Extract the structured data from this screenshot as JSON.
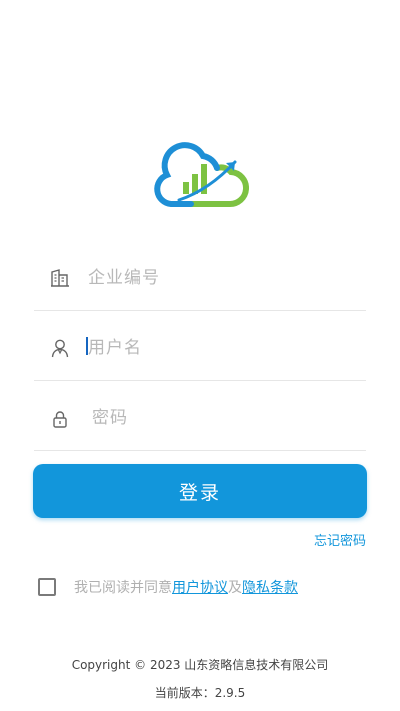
{
  "logo": {
    "icon": "cloud-chart-logo",
    "colors": {
      "blue": "#1e8fd6",
      "green": "#7dc242"
    }
  },
  "form": {
    "company_placeholder": "企业编号",
    "username_placeholder": "用户名",
    "password_placeholder": "密码"
  },
  "login_button": "登录",
  "forgot_password": "忘记密码",
  "agreement": {
    "prefix": "我已阅读并同意",
    "user_agreement": "用户协议",
    "conjunction": "及",
    "privacy_policy": "隐私条款"
  },
  "footer": {
    "copyright": "Copyright © 2023 山东资略信息技术有限公司",
    "version": "当前版本：2.9.5"
  },
  "colors": {
    "accent": "#1296db",
    "placeholder": "#b8b8b8",
    "divider": "#e6e6e6"
  }
}
